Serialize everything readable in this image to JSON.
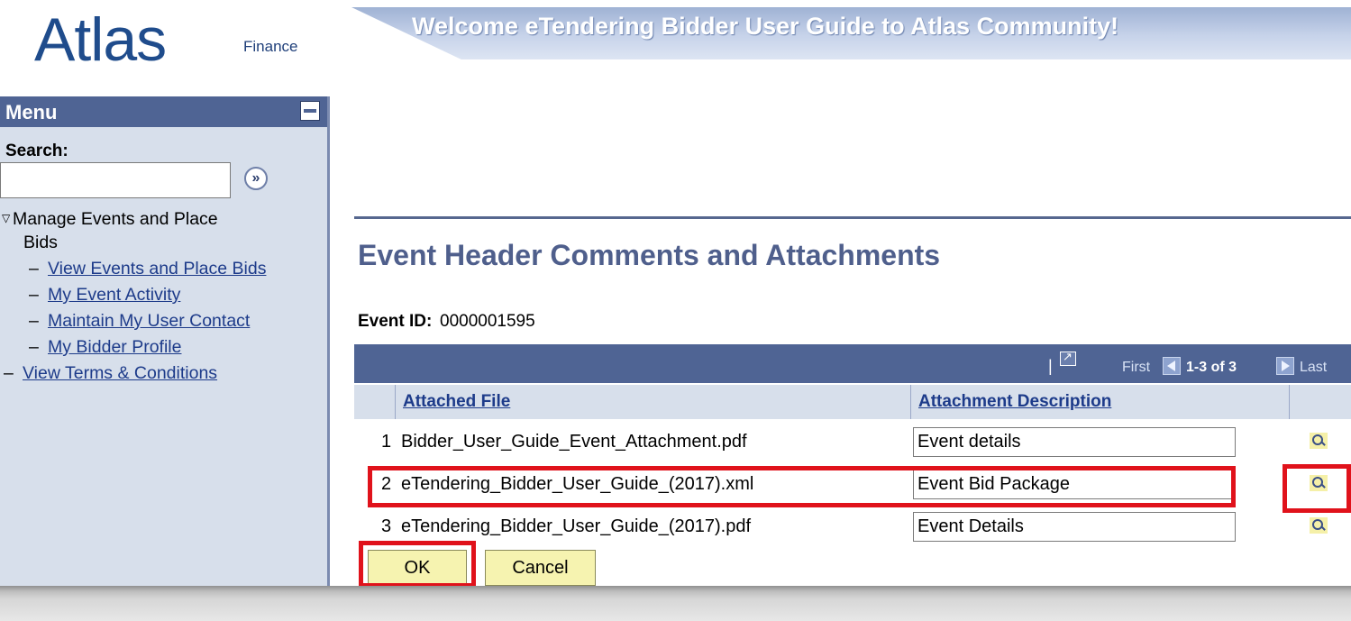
{
  "header": {
    "logo_main": "Atlas",
    "logo_sub": "Finance",
    "banner_text": "Welcome eTendering Bidder User Guide to Atlas Community!"
  },
  "sidebar": {
    "menu_title": "Menu",
    "search_label": "Search:",
    "search_value": "",
    "section_label_line1": "Manage Events and Place",
    "section_label_line2": "Bids",
    "items": [
      {
        "label": "View Events and Place Bids"
      },
      {
        "label": "My Event Activity"
      },
      {
        "label": "Maintain My User Contact"
      },
      {
        "label": "My Bidder Profile"
      }
    ],
    "terms_link": "View Terms & Conditions"
  },
  "main": {
    "page_title": "Event Header Comments and Attachments",
    "event_id_label": "Event ID:",
    "event_id_value": "0000001595",
    "grid": {
      "nav": {
        "first": "First",
        "range": "1-3 of 3",
        "last": "Last"
      },
      "columns": [
        "Attached File",
        "Attachment Description"
      ],
      "rows": [
        {
          "num": "1",
          "file": "Bidder_User_Guide_Event_Attachment.pdf",
          "description": "Event details"
        },
        {
          "num": "2",
          "file": "eTendering_Bidder_User_Guide_(2017).xml",
          "description": "Event Bid Package"
        },
        {
          "num": "3",
          "file": "eTendering_Bidder_User_Guide_(2017).pdf",
          "description": "Event Details"
        }
      ]
    },
    "buttons": {
      "ok": "OK",
      "cancel": "Cancel"
    }
  },
  "colors": {
    "accent": "#4f6494",
    "sidebar_bg": "#d7dfeb",
    "title": "#4f5f8c",
    "highlight": "#e0121b",
    "button_bg": "#f6f3b0"
  }
}
